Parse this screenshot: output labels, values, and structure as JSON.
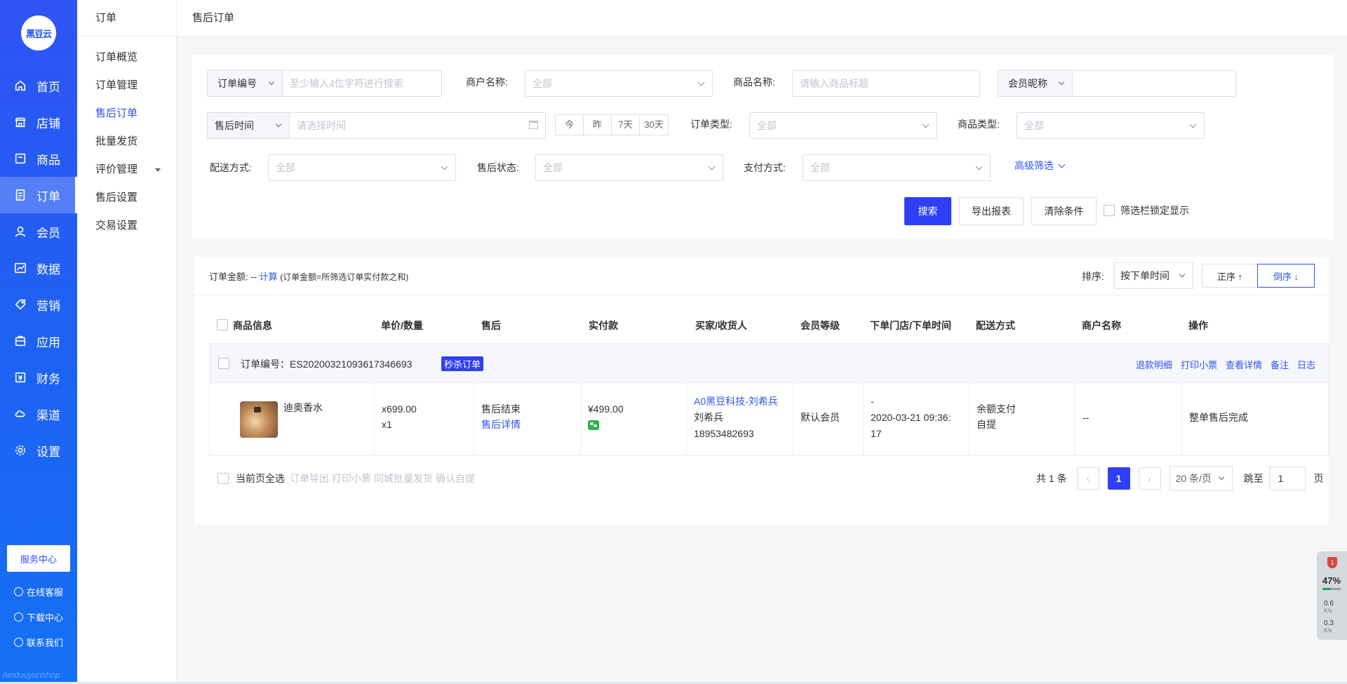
{
  "sidebar": {
    "logo_text": "黑豆云",
    "items": [
      {
        "label": "首页",
        "icon": "home-icon"
      },
      {
        "label": "店铺",
        "icon": "store-icon"
      },
      {
        "label": "商品",
        "icon": "goods-icon"
      },
      {
        "label": "订单",
        "icon": "order-icon",
        "active": true
      },
      {
        "label": "会员",
        "icon": "member-icon"
      },
      {
        "label": "数据",
        "icon": "data-icon"
      },
      {
        "label": "营销",
        "icon": "marketing-icon"
      },
      {
        "label": "应用",
        "icon": "app-icon"
      },
      {
        "label": "财务",
        "icon": "finance-icon"
      },
      {
        "label": "渠道",
        "icon": "channel-icon"
      },
      {
        "label": "设置",
        "icon": "settings-icon"
      }
    ],
    "service_center": "服务中心",
    "online_support": "在线客服",
    "download_center": "下载中心",
    "contact_us": "联系我们",
    "watermark": "heidouyunshop",
    "accent": "#2f53f5"
  },
  "subnav": {
    "title": "订单",
    "items": [
      {
        "label": "订单概览"
      },
      {
        "label": "订单管理"
      },
      {
        "label": "售后订单",
        "active": true
      },
      {
        "label": "批量发货"
      },
      {
        "label": "评价管理"
      },
      {
        "label": "售后设置"
      },
      {
        "label": "交易设置"
      }
    ]
  },
  "breadcrumb": "售后订单",
  "filters": {
    "order_no_prefix": "订单编号",
    "order_no_placeholder": "至少输入4位字符进行搜索",
    "merchant_label": "商户名称:",
    "merchant_value": "全部",
    "product_name_label": "商品名称:",
    "product_name_placeholder": "请输入商品标题",
    "member_prefix": "会员昵称",
    "member_value": "",
    "aftersale_time_prefix": "售后时间",
    "time_placeholder": "请选择时间",
    "quick_dates": [
      "今",
      "昨",
      "7天",
      "30天"
    ],
    "order_type_label": "订单类型:",
    "order_type_value": "全部",
    "product_type_label": "商品类型:",
    "product_type_value": "全部",
    "delivery_label": "配送方式:",
    "delivery_value": "全部",
    "aftersale_status_label": "售后状态:",
    "aftersale_status_value": "全部",
    "payment_label": "支付方式:",
    "payment_value": "全部",
    "advanced": "高级筛选",
    "search_btn": "搜索",
    "export_btn": "导出报表",
    "clear_btn": "清除条件",
    "lock_label": "筛选栏锁定显示"
  },
  "results": {
    "amount_label": "订单金额:",
    "amount_value": "--",
    "calc_link": "计算",
    "amount_note": "(订单金额=所筛选订单实付款之和)",
    "sort_label": "排序:",
    "sort_value": "按下单时间",
    "asc_label": "正序 ↑",
    "desc_label": "倒序 ↓",
    "columns": [
      "商品信息",
      "单价/数量",
      "售后",
      "实付款",
      "买家/收货人",
      "会员等级",
      "下单门店/下单时间",
      "配送方式",
      "商户名称",
      "操作"
    ],
    "order": {
      "order_no_label": "订单编号：",
      "order_no": "ES20200321093617346693",
      "badge": "秒杀订单",
      "actions": [
        "退款明细",
        "打印小票",
        "查看详情",
        "备注",
        "日志"
      ],
      "product_name": "迪奥香水",
      "unit_price": "x699.00",
      "quantity": "x1",
      "aftersale_status": "售后结束",
      "aftersale_link": "售后详情",
      "paid": "¥499.00",
      "buyer_link": "A0黑豆科技-刘希兵",
      "receiver": "刘希兵",
      "phone": "18953482693",
      "member_level": "默认会员",
      "store": "-",
      "order_time_line1": "2020-03-21 09:36:",
      "order_time_line2": "17",
      "delivery_line1": "余额支付",
      "delivery_line2": "自提",
      "merchant": "--",
      "operation": "整单售后完成"
    },
    "select_page": "当前页全选",
    "bulk_actions": [
      "订单导出",
      "打印小票",
      "同城批量发货",
      "确认自提"
    ],
    "total": "共 1 条",
    "current_page": "1",
    "page_size": "20 条/页",
    "jump_label": "跳至",
    "jump_value": "1",
    "page_unit": "页"
  },
  "widget": {
    "badge": "1",
    "percent": "47%",
    "up_speed": "0.6",
    "down_speed": "0.3",
    "speed_unit": "K/s"
  }
}
